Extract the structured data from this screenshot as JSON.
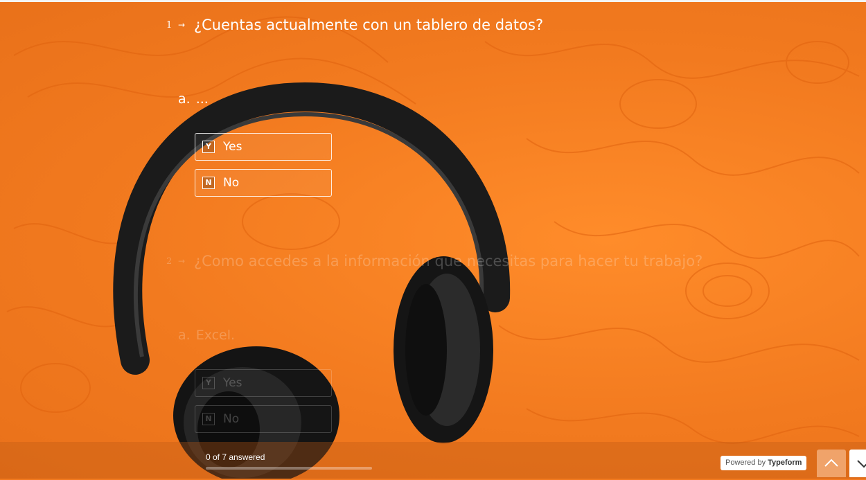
{
  "questions": [
    {
      "number": "1",
      "arrow": "→",
      "title": "¿Cuentas actualmente con un tablero de datos?",
      "sub_letter": "a.",
      "sub_text": "...",
      "choices": [
        {
          "key": "Y",
          "label": "Yes"
        },
        {
          "key": "N",
          "label": "No"
        }
      ]
    },
    {
      "number": "2",
      "arrow": "→",
      "title": "¿Como accedes a la información que necesitas para hacer tu trabajo?",
      "sub_letter": "a.",
      "sub_text": "Excel.",
      "choices": [
        {
          "key": "Y",
          "label": "Yes"
        },
        {
          "key": "N",
          "label": "No"
        }
      ]
    }
  ],
  "footer": {
    "progress_text": "0 of 7 answered",
    "progress_fraction": 0,
    "powered_prefix": "Powered by",
    "powered_brand": "Typeform"
  },
  "icons": {
    "nav_up": "chevron-up-icon",
    "nav_down": "chevron-down-icon"
  },
  "colors": {
    "background": "#f27a1f",
    "text": "#ffffff"
  }
}
